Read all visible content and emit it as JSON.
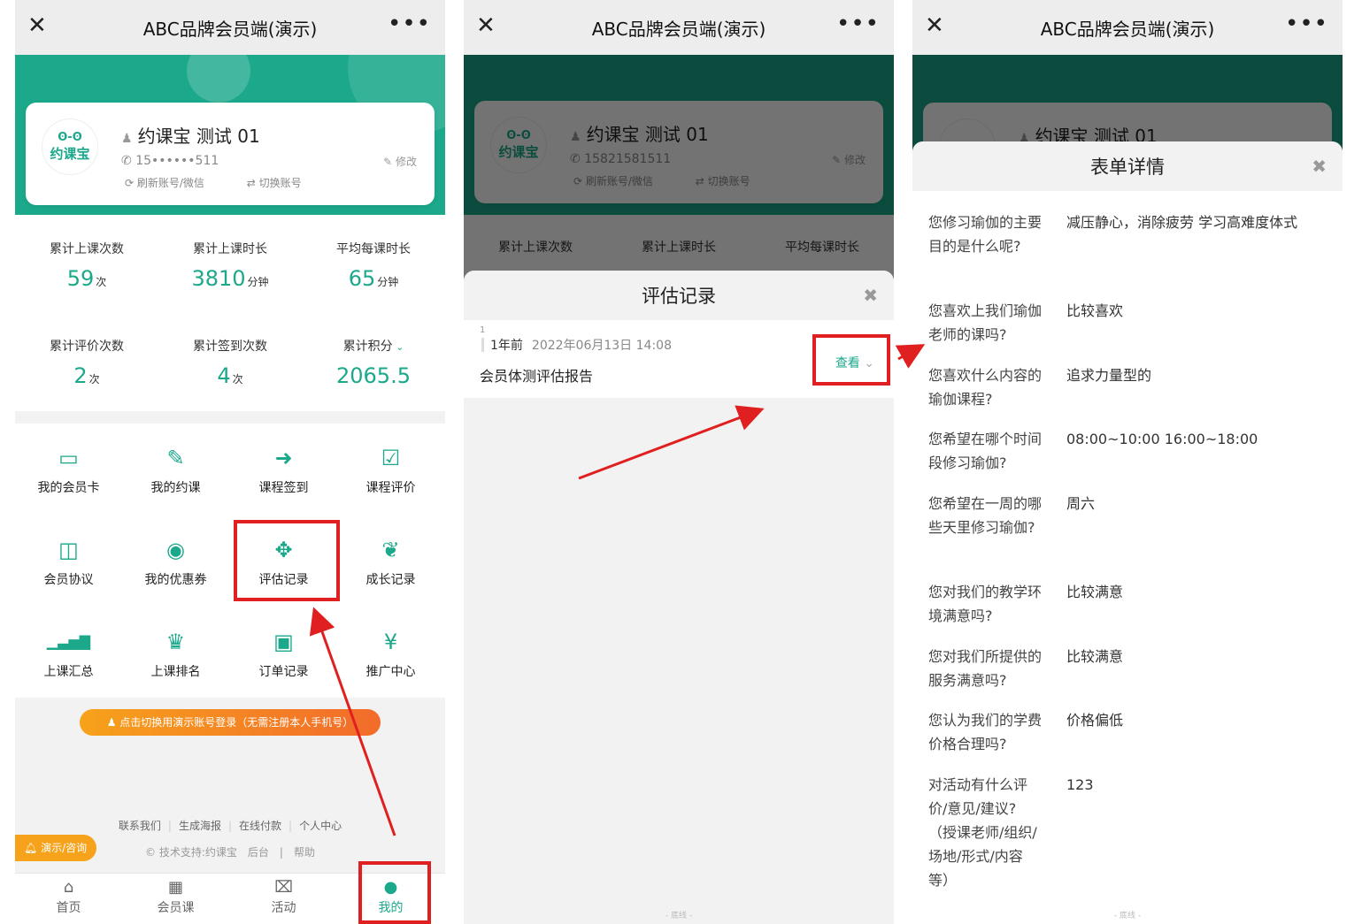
{
  "app_title": "ABC品牌会员端(演示)",
  "close_glyph": "✕",
  "more_glyph": "•••",
  "profile": {
    "logo_eyes": "ʘ-ʘ",
    "logo_text": "约课宝",
    "name": "约课宝 测试 01",
    "phone_masked": "15••••••511",
    "phone_full": "15821581511",
    "edit_label": "修改",
    "refresh_label": "刷新账号/微信",
    "switch_label": "切换账号"
  },
  "stats": [
    {
      "label": "累计上课次数",
      "value": "59",
      "unit": "次"
    },
    {
      "label": "累计上课时长",
      "value": "3810",
      "unit": "分钟"
    },
    {
      "label": "平均每课时长",
      "value": "65",
      "unit": "分钟"
    },
    {
      "label": "累计评价次数",
      "value": "2",
      "unit": "次"
    },
    {
      "label": "累计签到次数",
      "value": "4",
      "unit": "次"
    },
    {
      "label": "累计积分",
      "value": "2065.5",
      "unit": ""
    }
  ],
  "menu": [
    {
      "label": "我的会员卡",
      "icon": "card-icon",
      "glyph": "▭"
    },
    {
      "label": "我的约课",
      "icon": "edit-icon",
      "glyph": "✎"
    },
    {
      "label": "课程签到",
      "icon": "signin-icon",
      "glyph": "➜"
    },
    {
      "label": "课程评价",
      "icon": "check-icon",
      "glyph": "☑"
    },
    {
      "label": "会员协议",
      "icon": "book-icon",
      "glyph": "◫"
    },
    {
      "label": "我的优惠券",
      "icon": "coupon-icon",
      "glyph": "◉"
    },
    {
      "label": "评估记录",
      "icon": "crosshair-icon",
      "glyph": "✥"
    },
    {
      "label": "成长记录",
      "icon": "leaf-icon",
      "glyph": "❦"
    },
    {
      "label": "上课汇总",
      "icon": "signal-icon",
      "glyph": "▁▃▅▇"
    },
    {
      "label": "上课排名",
      "icon": "trophy-icon",
      "glyph": "♛"
    },
    {
      "label": "订单记录",
      "icon": "gift-icon",
      "glyph": "▣"
    },
    {
      "label": "推广中心",
      "icon": "yen-icon",
      "glyph": "¥"
    }
  ],
  "demo_login_banner": "点击切换用演示账号登录（无需注册本人手机号）",
  "footer_links": [
    "联系我们",
    "生成海报",
    "在线付款",
    "个人中心"
  ],
  "footer_copy": [
    "© 技术支持:约课宝",
    "后台",
    "帮助"
  ],
  "demo_consult": "演示/咨询",
  "tabs": [
    {
      "label": "首页",
      "glyph": "⌂"
    },
    {
      "label": "会员课",
      "glyph": "▦"
    },
    {
      "label": "活动",
      "glyph": "⌧"
    },
    {
      "label": "我的",
      "glyph": "●"
    }
  ],
  "eval_sheet": {
    "title": "评估记录",
    "close": "✖",
    "record": {
      "index": "1",
      "ago": "1年前",
      "datetime": "2022年06月13日 14:08",
      "name": "会员体测评估报告",
      "view_label": "查看"
    }
  },
  "form_sheet": {
    "title": "表单详情",
    "close": "✖",
    "items": [
      {
        "q": "您修习瑜伽的主要目的是什么呢?",
        "a": "减压静心，消除疲劳 学习高难度体式"
      },
      {
        "q": "您喜欢上我们瑜伽老师的课吗?",
        "a": "比较喜欢"
      },
      {
        "q": "您喜欢什么内容的瑜伽课程?",
        "a": "追求力量型的"
      },
      {
        "q": "您希望在哪个时间段修习瑜伽?",
        "a": "08:00~10:00 16:00~18:00"
      },
      {
        "q": "您希望在一周的哪些天里修习瑜伽?",
        "a": "周六"
      },
      {
        "q": "您对我们的教学环境满意吗?",
        "a": "比较满意"
      },
      {
        "q": "您对我们所提供的服务满意吗?",
        "a": "比较满意"
      },
      {
        "q": "您认为我们的学费价格合理吗?",
        "a": "价格偏低"
      },
      {
        "q": "对活动有什么评价/意见/建议?（授课老师/组织/场地/形式/内容等）",
        "a": "123"
      }
    ]
  },
  "bottom_line": "- 底线 -",
  "colors": {
    "accent": "#1ba88b",
    "highlight": "#e02020",
    "orange": "#f7a21b"
  }
}
